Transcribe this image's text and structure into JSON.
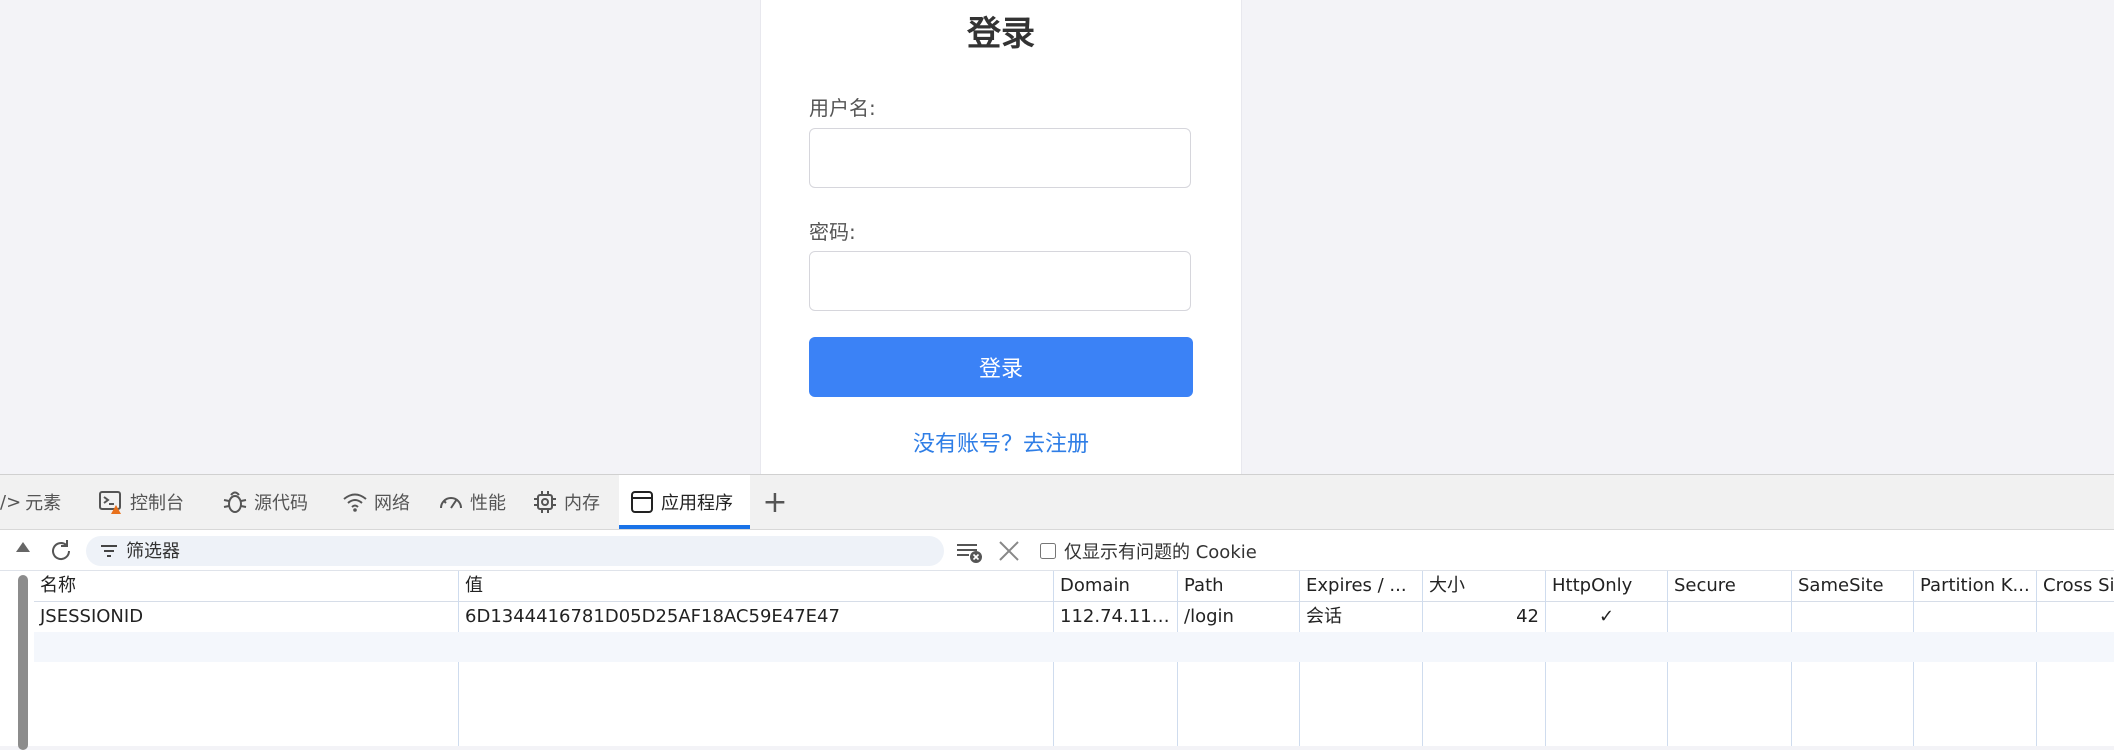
{
  "login": {
    "title": "登录",
    "username_label": "用户名:",
    "username_value": "",
    "password_label": "密码:",
    "password_value": "",
    "submit_label": "登录",
    "register_link": "没有账号？去注册"
  },
  "devtools": {
    "tabs": [
      {
        "label": "元素",
        "icon": "code-brackets-icon"
      },
      {
        "label": "控制台",
        "icon": "console-icon"
      },
      {
        "label": "源代码",
        "icon": "bug-icon"
      },
      {
        "label": "网络",
        "icon": "wifi-icon"
      },
      {
        "label": "性能",
        "icon": "gauge-icon"
      },
      {
        "label": "内存",
        "icon": "chip-icon"
      },
      {
        "label": "应用程序",
        "icon": "window-icon",
        "active": true
      }
    ],
    "add_tab_label": "+",
    "filter_placeholder": "筛选器",
    "only_issues_label": "仅显示有问题的 Cookie",
    "table": {
      "columns": [
        "名称",
        "值",
        "Domain",
        "Path",
        "Expires / ...",
        "大小",
        "HttpOnly",
        "Secure",
        "SameSite",
        "Partition K...",
        "Cross Si"
      ],
      "rows": [
        [
          "JSESSIONID",
          "6D1344416781D05D25AF18AC59E47E47",
          "112.74.112....",
          "/login",
          "会话",
          "42",
          "✓",
          "",
          "",
          "",
          ""
        ]
      ]
    },
    "colors": {
      "active_tab_underline": "#1a73e8",
      "login_button": "#3b82f6",
      "link": "#2f7ee6"
    }
  }
}
